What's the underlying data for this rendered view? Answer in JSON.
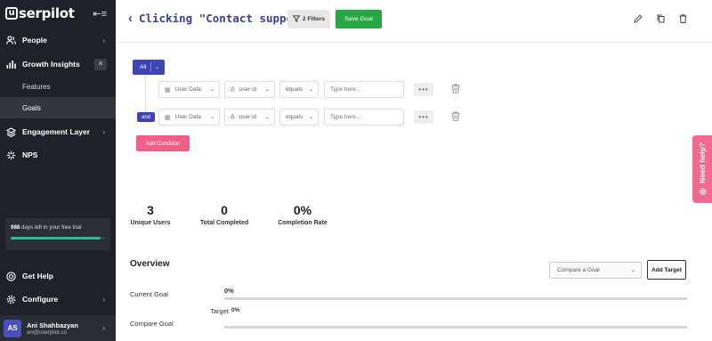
{
  "sidebar": {
    "logo": "serpilot",
    "logo_letter": "u",
    "items": [
      {
        "label": "People",
        "icon": "people-icon"
      },
      {
        "label": "Growth Insights",
        "icon": "bar-chart-icon"
      },
      {
        "label": "Engagement Layer",
        "icon": "layers-icon"
      },
      {
        "label": "NPS",
        "icon": "nps-icon"
      }
    ],
    "sub_items": [
      {
        "label": "Features"
      },
      {
        "label": "Goals"
      }
    ],
    "trial": {
      "days": "988",
      "text": " days left in your free trial",
      "progress_percent": 95
    },
    "bottom": [
      {
        "label": "Get Help",
        "icon": "help-icon"
      },
      {
        "label": "Configure",
        "icon": "gear-icon"
      }
    ],
    "user": {
      "initials": "AS",
      "name": "Ani Shahbazyan",
      "email": "ani@userpilot.co"
    }
  },
  "header": {
    "title": "Clicking \"Contact support\"",
    "filters_label": "2 Filters",
    "save_label": "Save Goal"
  },
  "filters": {
    "group_operator": "All",
    "conditions": [
      {
        "connector": "",
        "type": "User Data",
        "field": "user id",
        "operator": "equals",
        "placeholder": "Type here..."
      },
      {
        "connector": "and",
        "type": "User Data",
        "field": "user id",
        "operator": "equals",
        "placeholder": "Type here..."
      }
    ],
    "add_label": "Add Condition"
  },
  "need_help": "Need help?",
  "stats": [
    {
      "value": "3",
      "label": "Unique Users"
    },
    {
      "value": "0",
      "label": "Total Completed"
    },
    {
      "value": "0%",
      "label": "Completion Rate"
    }
  ],
  "overview": {
    "title": "Overview",
    "compare_placeholder": "Compare a Goal",
    "add_target_label": "Add Target",
    "current_goal_label": "Current Goal",
    "current_goal_value": "0%",
    "target_label": "Target",
    "target_value": "0%",
    "compare_goal_label": "Compare Goal"
  },
  "colors": {
    "sidebar_bg": "#1f2127",
    "primary": "#3f44b5",
    "save_green": "#27a844",
    "pink": "#f05f88",
    "trial_progress": "#27c18a"
  }
}
